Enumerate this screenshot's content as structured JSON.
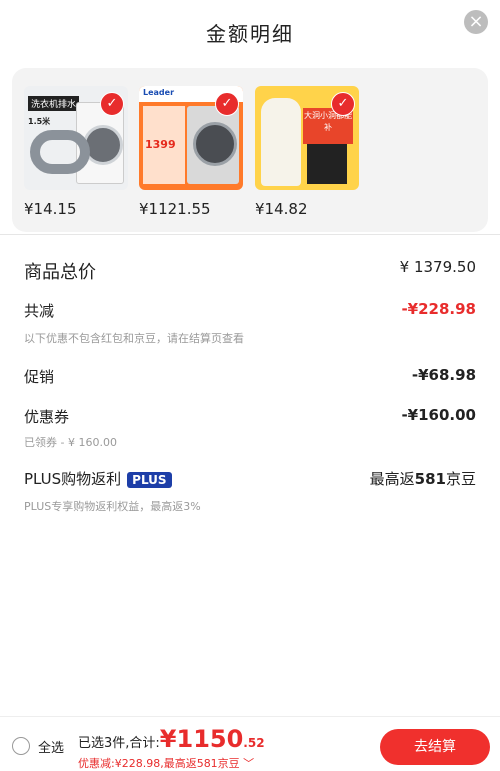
{
  "header": {
    "title": "金额明细",
    "close_icon": "close-icon"
  },
  "products": [
    {
      "price": "¥14.15",
      "thumb_label": "洗衣机排水",
      "thumb_label2": "1.5米"
    },
    {
      "price": "¥1121.55",
      "brand": "Leader",
      "promo": "1399"
    },
    {
      "price": "¥14.82",
      "promo_text": "大洞小洞都能补"
    }
  ],
  "summary": {
    "total_label": "商品总价",
    "total_value": "¥ 1379.50",
    "discount_label": "共减",
    "discount_value": "-¥228.98",
    "discount_note": "以下优惠不包含红包和京豆，请在结算页查看",
    "promo_label": "促销",
    "promo_value": "-¥68.98",
    "coupon_label": "优惠券",
    "coupon_value": "-¥160.00",
    "coupon_note": "已领券 - ¥ 160.00",
    "plus_label": "PLUS购物返利",
    "plus_badge": "PLUS",
    "plus_value_prefix": "最高返",
    "plus_value_num": "581",
    "plus_value_suffix": "京豆",
    "plus_note": "PLUS专享购物返利权益，最高返3%"
  },
  "footer": {
    "select_all": "全选",
    "selected_text": "已选3件,合计:",
    "total_big": "¥1150",
    "total_cents": ".52",
    "discount_line": "优惠减:¥228.98,最高返581京豆 ﹀",
    "checkout": "去结算"
  },
  "colors": {
    "accent_red": "#e82c2c",
    "plus_blue": "#1d3ea8"
  }
}
